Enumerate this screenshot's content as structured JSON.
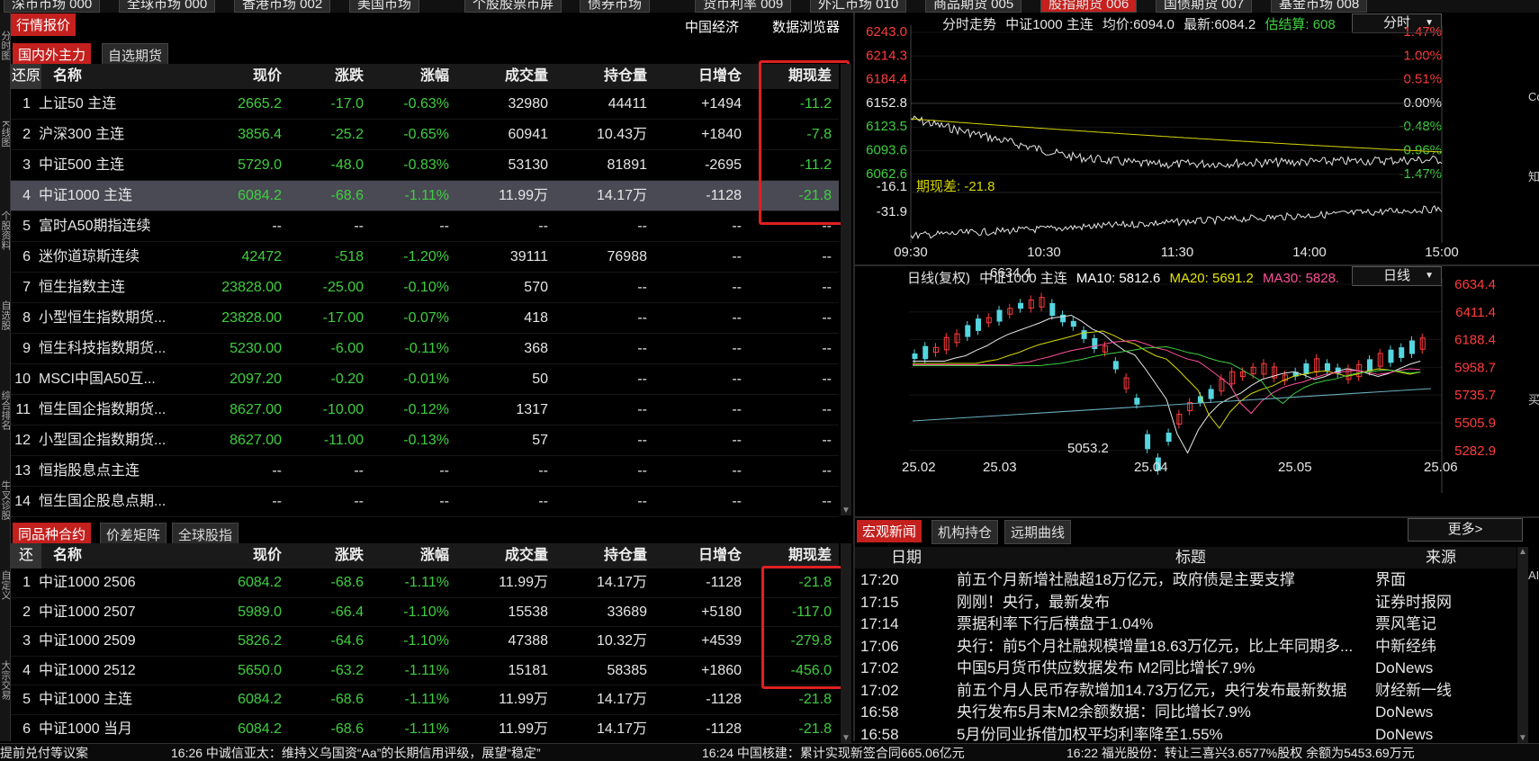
{
  "top_tabs": [
    "深市市场 000",
    "全球市场 000",
    "香港市场 002",
    "美国市场",
    "个股股票市屏",
    "债券市场",
    "货币利率 009",
    "外汇市场 010",
    "商品期货 005",
    "股指期货 006",
    "国债期货 007",
    "基金市场 008"
  ],
  "header": {
    "label": "行情报价",
    "link1": "中国经济",
    "link2": "数据浏览器"
  },
  "left_vtabs": [
    "分时图",
    "K线图",
    "个股资料",
    "自选股",
    "综合排名",
    "牛叉诊股",
    "自定义",
    "大宗交易"
  ],
  "top_panel": {
    "tabs": [
      "国内外主力",
      "自选期货"
    ],
    "restore": "还原",
    "columns": [
      "名称",
      "现价",
      "涨跌",
      "涨幅",
      "成交量",
      "持仓量",
      "日增仓",
      "期现差"
    ],
    "rows": [
      {
        "idx": "1",
        "name": "上证50 主连",
        "price": "2665.2",
        "change": "-17.0",
        "pct": "-0.63%",
        "vol": "32980",
        "oi": "44411",
        "doi": "+1494",
        "basis": "-11.2"
      },
      {
        "idx": "2",
        "name": "沪深300 主连",
        "price": "3856.4",
        "change": "-25.2",
        "pct": "-0.65%",
        "vol": "60941",
        "oi": "10.43万",
        "doi": "+1840",
        "basis": "-7.8"
      },
      {
        "idx": "3",
        "name": "中证500 主连",
        "price": "5729.0",
        "change": "-48.0",
        "pct": "-0.83%",
        "vol": "53130",
        "oi": "81891",
        "doi": "-2695",
        "basis": "-11.2"
      },
      {
        "idx": "4",
        "name": "中证1000 主连",
        "price": "6084.2",
        "change": "-68.6",
        "pct": "-1.11%",
        "vol": "11.99万",
        "oi": "14.17万",
        "doi": "-1128",
        "basis": "-21.8"
      },
      {
        "idx": "5",
        "name": "富时A50期指连续",
        "price": "--",
        "change": "--",
        "pct": "--",
        "vol": "--",
        "oi": "--",
        "doi": "--",
        "basis": "--"
      },
      {
        "idx": "6",
        "name": "迷你道琼斯连续",
        "price": "42472",
        "change": "-518",
        "pct": "-1.20%",
        "vol": "39111",
        "oi": "76988",
        "doi": "--",
        "basis": "--"
      },
      {
        "idx": "7",
        "name": "恒生指数主连",
        "price": "23828.00",
        "change": "-25.00",
        "pct": "-0.10%",
        "vol": "570",
        "oi": "--",
        "doi": "--",
        "basis": "--"
      },
      {
        "idx": "8",
        "name": "小型恒生指数期货...",
        "price": "23828.00",
        "change": "-17.00",
        "pct": "-0.07%",
        "vol": "418",
        "oi": "--",
        "doi": "--",
        "basis": "--"
      },
      {
        "idx": "9",
        "name": "恒生科技指数期货...",
        "price": "5230.00",
        "change": "-6.00",
        "pct": "-0.11%",
        "vol": "368",
        "oi": "--",
        "doi": "--",
        "basis": "--"
      },
      {
        "idx": "10",
        "name": "MSCI中国A50互...",
        "price": "2097.20",
        "change": "-0.20",
        "pct": "-0.01%",
        "vol": "50",
        "oi": "--",
        "doi": "--",
        "basis": "--"
      },
      {
        "idx": "11",
        "name": "恒生国企指数期货...",
        "price": "8627.00",
        "change": "-10.00",
        "pct": "-0.12%",
        "vol": "1317",
        "oi": "--",
        "doi": "--",
        "basis": "--"
      },
      {
        "idx": "12",
        "name": "小型国企指数期货...",
        "price": "8627.00",
        "change": "-11.00",
        "pct": "-0.13%",
        "vol": "57",
        "oi": "--",
        "doi": "--",
        "basis": "--"
      },
      {
        "idx": "13",
        "name": "恒指股息点主连",
        "price": "--",
        "change": "--",
        "pct": "--",
        "vol": "--",
        "oi": "--",
        "doi": "--",
        "basis": "--"
      },
      {
        "idx": "14",
        "name": "恒生国企股息点期...",
        "price": "--",
        "change": "--",
        "pct": "--",
        "vol": "--",
        "oi": "--",
        "doi": "--",
        "basis": "--"
      }
    ]
  },
  "bottom_panel": {
    "tabs": [
      "同品种合约",
      "价差矩阵",
      "全球股指"
    ],
    "restore": "还",
    "columns": [
      "名称",
      "现价",
      "涨跌",
      "涨幅",
      "成交量",
      "持仓量",
      "日增仓",
      "期现差"
    ],
    "rows": [
      {
        "idx": "1",
        "name": "中证1000 2506",
        "price": "6084.2",
        "change": "-68.6",
        "pct": "-1.11%",
        "vol": "11.99万",
        "oi": "14.17万",
        "doi": "-1128",
        "basis": "-21.8"
      },
      {
        "idx": "2",
        "name": "中证1000 2507",
        "price": "5989.0",
        "change": "-66.4",
        "pct": "-1.10%",
        "vol": "15538",
        "oi": "33689",
        "doi": "+5180",
        "basis": "-117.0"
      },
      {
        "idx": "3",
        "name": "中证1000 2509",
        "price": "5826.2",
        "change": "-64.6",
        "pct": "-1.10%",
        "vol": "47388",
        "oi": "10.32万",
        "doi": "+4539",
        "basis": "-279.8"
      },
      {
        "idx": "4",
        "name": "中证1000 2512",
        "price": "5650.0",
        "change": "-63.2",
        "pct": "-1.11%",
        "vol": "15181",
        "oi": "58385",
        "doi": "+1860",
        "basis": "-456.0"
      },
      {
        "idx": "5",
        "name": "中证1000 主连",
        "price": "6084.2",
        "change": "-68.6",
        "pct": "-1.11%",
        "vol": "11.99万",
        "oi": "14.17万",
        "doi": "-1128",
        "basis": "-21.8"
      },
      {
        "idx": "6",
        "name": "中证1000 当月",
        "price": "6084.2",
        "change": "-68.6",
        "pct": "-1.11%",
        "vol": "11.99万",
        "oi": "14.17万",
        "doi": "-1128",
        "basis": "-21.8"
      }
    ]
  },
  "intraday": {
    "header": {
      "title": "分时走势",
      "name": "中证1000 主连",
      "avg_label": "均价:",
      "avg": "6094.0",
      "last_label": "最新:",
      "last": "6084.2",
      "settle": "估结算: 608"
    },
    "period": "分时",
    "left_axis": [
      "6243.0",
      "6214.3",
      "6184.4",
      "6152.8",
      "6123.5",
      "6093.6",
      "6062.6"
    ],
    "right_axis": [
      "1.47%",
      "1.00%",
      "0.51%",
      "0.00%",
      "-0.48%",
      "-0.96%",
      "-1.47%"
    ],
    "basis_top": "-16.1",
    "basis_label": "期现差: -21.8",
    "basis_bottom": "-31.9",
    "times": [
      "09:30",
      "10:30",
      "11:30",
      "14:00",
      "15:00"
    ]
  },
  "kline": {
    "header": {
      "title": "日线(复权)",
      "name": "中证1000 主连",
      "ma10": "MA10: 5812.6",
      "ma20": "MA20: 5691.2",
      "ma30": "MA30: 5828."
    },
    "period": "日线",
    "right_axis": [
      "6634.4",
      "6411.4",
      "6188.4",
      "5958.7",
      "5735.7",
      "5505.9",
      "5282.9"
    ],
    "high_label": "6634.4",
    "low_label": "5053.2",
    "dates": [
      "25.02",
      "25.03",
      "25.04",
      "25.05",
      "25.06"
    ]
  },
  "news": {
    "tabs": [
      "宏观新闻",
      "机构持仓",
      "远期曲线"
    ],
    "more": "更多>",
    "columns": [
      "日期",
      "标题",
      "来源"
    ],
    "rows": [
      {
        "time": "17:20",
        "title": "前五个月新增社融超18万亿元，政府债是主要支撑",
        "source": "界面"
      },
      {
        "time": "17:15",
        "title": "刚刚！央行，最新发布",
        "source": "证券时报网"
      },
      {
        "time": "17:14",
        "title": "票据利率下行后横盘于1.04%",
        "source": "票风笔记"
      },
      {
        "time": "17:06",
        "title": "央行：前5个月社融规模增量18.63万亿元，比上年同期多...",
        "source": "中新经纬"
      },
      {
        "time": "17:02",
        "title": "中国5月货币供应数据发布 M2同比增长7.9%",
        "source": "DoNews"
      },
      {
        "time": "17:02",
        "title": "前五个月人民币存款增加14.73万亿元，央行发布最新数据",
        "source": "财经新一线"
      },
      {
        "time": "16:58",
        "title": "央行发布5月末M2余额数据：同比增长7.9%",
        "source": "DoNews"
      },
      {
        "time": "16:58",
        "title": "5月份同业拆借加权平均利率降至1.55%",
        "source": "DoNews"
      }
    ]
  },
  "ticker": [
    "提前兑付等议案",
    "16:26 中诚信亚太：维持义乌国资“Aa”的长期信用评级，展望“稳定”",
    "16:24 中国核建：累计实现新签合同665.06亿元",
    "16:22 福光股份：转让三喜兴3.6577%股权 余额为5453.69万元"
  ],
  "right_edge": [
    "Co",
    "知",
    "买",
    "AI"
  ],
  "colors": {
    "accent": "#c3201e",
    "up": "#ff3c3c",
    "down": "#3fcf3f",
    "highlight": "#e02020"
  }
}
